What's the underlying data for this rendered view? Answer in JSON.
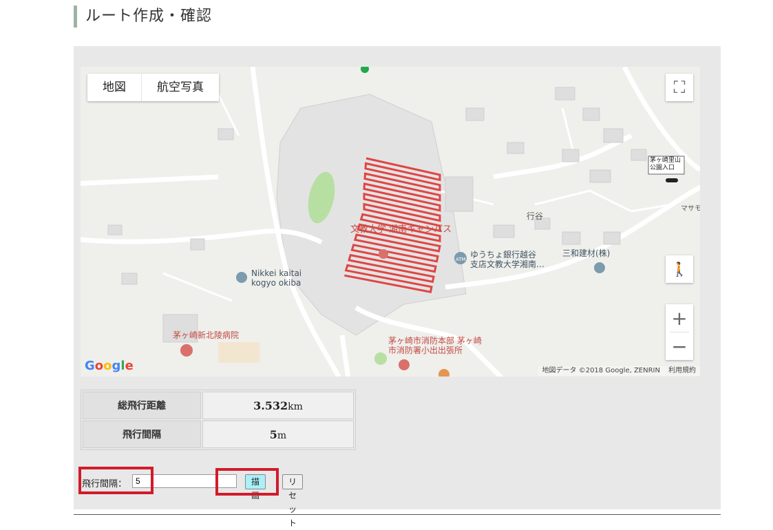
{
  "page": {
    "title": "ルート作成・確認"
  },
  "map": {
    "type_buttons": [
      "地図",
      "航空写真"
    ],
    "labels": {
      "campus": "文教大学 湘南キャンパス",
      "nikkei": "Nikkei kaitai\nkogyo okiba",
      "hospital": "茅ヶ崎新北陵病院",
      "fire": "茅ヶ崎市消防本部 茅ヶ崎\n市消防署小出出張所",
      "bank": "ゆうちょ銀行越谷\n支店文教大学湘南…",
      "sanwa": "三和建材(株)",
      "gyoya": "行谷",
      "park": "茅ヶ崎里山\n公園入口",
      "masa": "マサモ",
      "atm": "ATM"
    },
    "google_logo": "Google",
    "attribution": "地図データ ©2018 Google, ZENRIN",
    "terms": "利用規約",
    "icons": [
      "fullscreen-icon",
      "pegman-icon",
      "zoom-in-icon",
      "zoom-out-icon"
    ],
    "route_color": "#e04545"
  },
  "stats": {
    "rows": [
      {
        "label": "総飛行距離",
        "value": "3.532",
        "unit": "km"
      },
      {
        "label": "飛行間隔",
        "value": "5",
        "unit": "m"
      }
    ]
  },
  "controls": {
    "interval_label": "飛行間隔：",
    "interval_value": "5",
    "draw_button": "描画",
    "reset_button": "リセット"
  }
}
